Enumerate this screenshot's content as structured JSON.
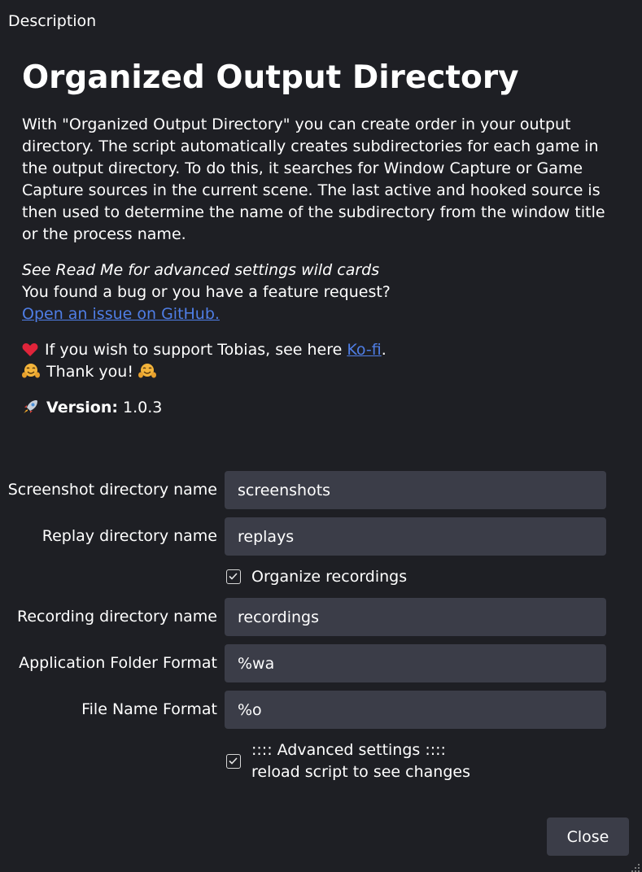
{
  "header": {
    "section_label": "Description"
  },
  "description": {
    "title": "Organized Output Directory",
    "paragraph": "With \"Organized Output Directory\" you can create order in your output directory. The script automatically creates subdirectories for each game in the output directory. To do this, it searches for Window Capture or Game Capture sources in the current scene. The last active and hooked source is then used to determine the name of the subdirectory from the window title or the process name.",
    "readme_note": "See Read Me for advanced settings wild cards",
    "bug_question": "You found a bug or you have a feature request?",
    "issue_link": "Open an issue on GitHub.",
    "support_text": "If you wish to support Tobias, see here ",
    "kofi_link": "Ko-fi",
    "support_end": ".",
    "thanks": "Thank you!",
    "version_label": "Version:",
    "version_value": "1.0.3"
  },
  "form": {
    "screenshot": {
      "label": "Screenshot directory name",
      "value": "screenshots"
    },
    "replay": {
      "label": "Replay directory name",
      "value": "replays"
    },
    "organize_recordings": {
      "label": "Organize recordings",
      "checked": true
    },
    "recording": {
      "label": "Recording directory name",
      "value": "recordings"
    },
    "app_folder": {
      "label": "Application Folder Format",
      "value": "%wa"
    },
    "file_name": {
      "label": "File Name Format",
      "value": "%o"
    },
    "advanced": {
      "line1": ":::: Advanced settings ::::",
      "line2": "reload script to see changes",
      "checked": true
    }
  },
  "footer": {
    "close_label": "Close"
  },
  "colors": {
    "background": "#1e1f24",
    "input": "#3b3d48",
    "link": "#4f7ee6"
  },
  "icons": [
    "heart-icon",
    "hugging-face-icon",
    "rocket-icon",
    "checkbox-checked-icon",
    "resize-grip-icon"
  ]
}
